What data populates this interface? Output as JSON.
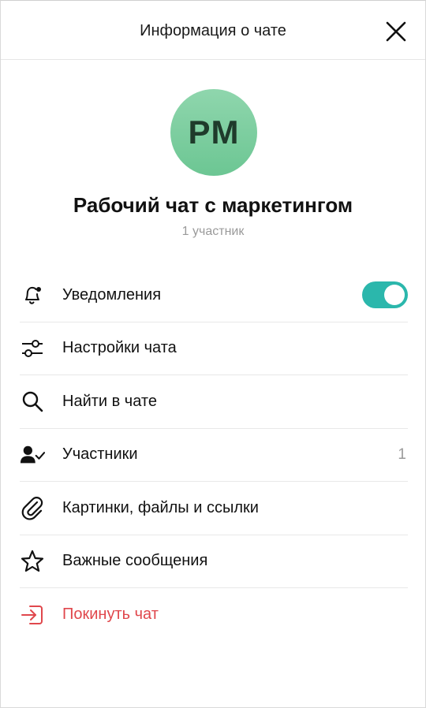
{
  "header": {
    "title": "Информация о чате",
    "close_icon": "close-icon"
  },
  "chat": {
    "initials": "PM",
    "name": "Рабочий чат с маркетингом",
    "members_caption": "1 участник",
    "avatar_colors": [
      "#8fd6ad",
      "#6cc693"
    ]
  },
  "menu": {
    "items": [
      {
        "label": "Уведомления",
        "icon": "bell-icon",
        "toggle_on": true
      },
      {
        "label": "Настройки чата",
        "icon": "sliders-icon"
      },
      {
        "label": "Найти в чате",
        "icon": "search-icon"
      },
      {
        "label": "Участники",
        "icon": "user-check-icon",
        "count": "1"
      },
      {
        "label": "Картинки, файлы и ссылки",
        "icon": "paperclip-icon"
      },
      {
        "label": "Важные сообщения",
        "icon": "star-icon"
      },
      {
        "label": "Покинуть чат",
        "icon": "exit-icon",
        "color": "#e0474c"
      }
    ]
  },
  "colors": {
    "accent": "#2bb7ac",
    "danger": "#e0474c",
    "muted": "#9a9a9a"
  }
}
